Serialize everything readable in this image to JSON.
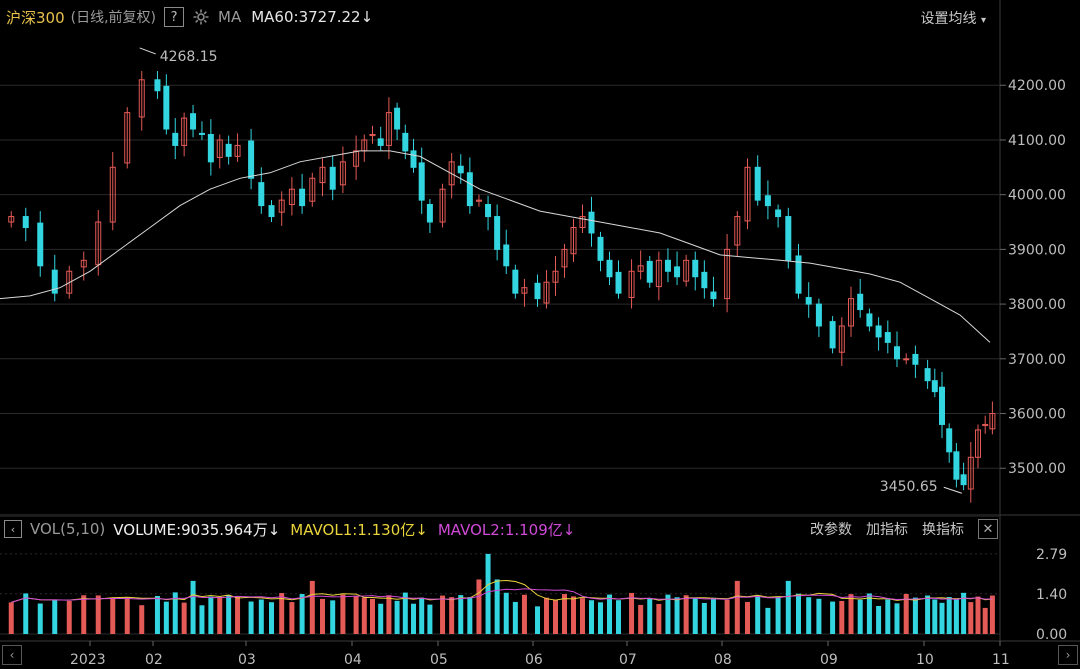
{
  "header": {
    "title": "沪深300",
    "subtitle": "(日线,前复权)",
    "help": "?",
    "ma_label": "MA",
    "ma60": "MA60:3727.22",
    "ma60_arrow": "↓",
    "settings": "设置均线",
    "settings_caret": "▾"
  },
  "volume_header": {
    "toggle": "‹",
    "label": "VOL(5,10)",
    "volume": "VOLUME:9035.964万",
    "volume_arrow": "↓",
    "mavol1": "MAVOL1:1.130亿",
    "mavol1_arrow": "↓",
    "mavol2": "MAVOL2:1.109亿",
    "mavol2_arrow": "↓",
    "action1": "改参数",
    "action2": "加指标",
    "action3": "换指标",
    "close": "✕"
  },
  "nav": {
    "left": "‹",
    "right": "›"
  },
  "colors": {
    "up": "#e45a56",
    "down": "#33d6e0",
    "ma60": "#d8d8d8",
    "mavol1": "#e8d33a",
    "mavol2": "#d04ad8",
    "grid": "#2a2a2a"
  },
  "chart_data": [
    {
      "type": "candlestick",
      "ylim": [
        3420,
        4290
      ],
      "yticks": [
        "4200.00",
        "4100.00",
        "4000.00",
        "3900.00",
        "3800.00",
        "3700.00",
        "3600.00",
        "3500.00"
      ],
      "ytick_values": [
        4200,
        4100,
        4000,
        3900,
        3800,
        3700,
        3600,
        3500
      ],
      "xticks": [
        "2023",
        "02",
        "03",
        "04",
        "05",
        "06",
        "07",
        "08",
        "09",
        "10",
        "11"
      ],
      "annotations": [
        {
          "text": "4268.15",
          "value": 4268.15,
          "month_index": 0.9
        },
        {
          "text": "3450.65",
          "value": 3450.65,
          "month_index": 9.55
        }
      ],
      "closes_by_month": {
        "start": [
          3960,
          3940,
          3870,
          3820,
          3860,
          3880,
          3950,
          4050,
          4150,
          4210
        ],
        "02": [
          4190,
          4120,
          4090,
          4140,
          4120,
          4110,
          4060,
          4100,
          4070,
          4090
        ],
        "03": [
          4030,
          3980,
          3960,
          3990,
          4010,
          3980,
          4030,
          4050,
          4010,
          4060
        ],
        "04": [
          4080,
          4100,
          4110,
          4090,
          4150,
          4120,
          4080,
          4050,
          3990,
          3950
        ],
        "05": [
          4010,
          4060,
          4040,
          3980,
          3990,
          3960,
          3900,
          3870,
          3820,
          3830
        ],
        "06": [
          3810,
          3840,
          3860,
          3900,
          3940,
          3960,
          3930,
          3880,
          3850,
          3820
        ],
        "07": [
          3860,
          3870,
          3840,
          3880,
          3860,
          3850,
          3880,
          3850,
          3830,
          3810
        ],
        "08": [
          3900,
          3960,
          4050,
          3990,
          3980,
          3960,
          3880,
          3820,
          3800,
          3760
        ],
        "09": [
          3720,
          3760,
          3810,
          3790,
          3760,
          3740,
          3730,
          3700,
          3700,
          3690
        ],
        "10": [
          3660,
          3640,
          3580,
          3530,
          3480,
          3470,
          3520,
          3570,
          3580,
          3600
        ]
      },
      "ma60": [
        3810,
        3815,
        3830,
        3860,
        3900,
        3940,
        3980,
        4010,
        4030,
        4040,
        4060,
        4070,
        4080,
        4080,
        4070,
        4040,
        4010,
        3990,
        3970,
        3960,
        3950,
        3940,
        3930,
        3910,
        3890,
        3885,
        3880,
        3875,
        3865,
        3855,
        3840,
        3810,
        3780,
        3730
      ]
    },
    {
      "type": "bar",
      "ylim": [
        0,
        3.1
      ],
      "yticks": [
        "2.79",
        "1.40",
        "0.00"
      ],
      "ytick_values": [
        2.79,
        1.4,
        0.0
      ],
      "unit": "亿"
    }
  ]
}
